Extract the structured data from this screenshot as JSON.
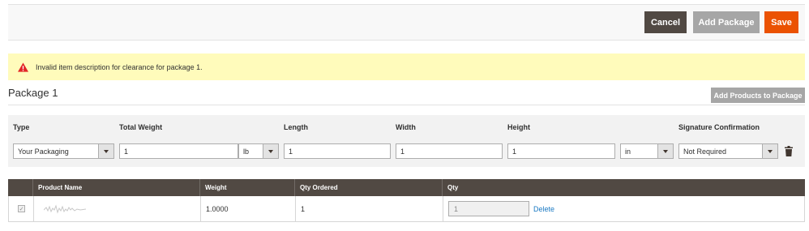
{
  "toolbar": {
    "cancel_label": "Cancel",
    "add_package_label": "Add Package",
    "save_label": "Save"
  },
  "alert": {
    "icon": "warning-icon",
    "message": "Invalid item description for clearance for package 1."
  },
  "package": {
    "title": "Package 1",
    "add_products_label": "Add Products to Package"
  },
  "form": {
    "labels": {
      "type": "Type",
      "total_weight": "Total Weight",
      "length": "Length",
      "width": "Width",
      "height": "Height",
      "signature": "Signature Confirmation"
    },
    "type_value": "Your Packaging",
    "total_weight_value": "1",
    "weight_unit": "lb",
    "length_value": "1",
    "width_value": "1",
    "height_value": "1",
    "dimension_unit": "in",
    "signature_value": "Not Required",
    "delete_icon": "trash-icon"
  },
  "grid": {
    "headers": [
      "",
      "Product Name",
      "Weight",
      "Qty Ordered",
      "Qty"
    ],
    "rows": [
      {
        "weight": "1.0000",
        "qty_ordered": "1",
        "qty": "1",
        "delete_label": "Delete"
      }
    ]
  },
  "colors": {
    "accent": "#eb5202",
    "dark": "#514943",
    "alert_bg": "#fffbbb",
    "link": "#1979c3"
  }
}
